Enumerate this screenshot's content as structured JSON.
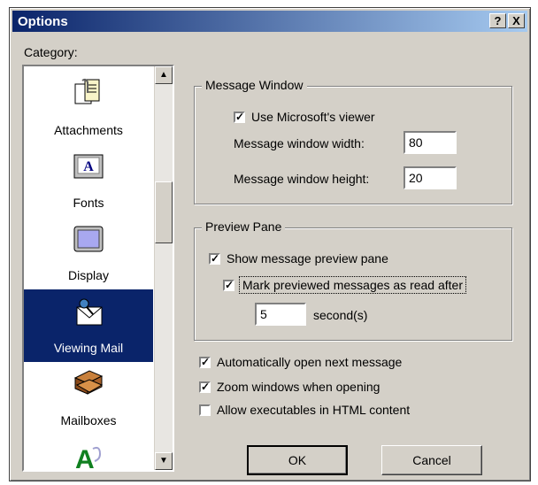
{
  "window": {
    "title": "Options",
    "help_button": "?",
    "close_button": "X"
  },
  "category_label": "Category:",
  "categories": [
    {
      "label": "Attachments",
      "icon": "attachments-icon"
    },
    {
      "label": "Fonts",
      "icon": "fonts-icon"
    },
    {
      "label": "Display",
      "icon": "display-icon"
    },
    {
      "label": "Viewing Mail",
      "icon": "viewing-mail-icon",
      "selected": true
    },
    {
      "label": "Mailboxes",
      "icon": "mailboxes-icon"
    },
    {
      "label": "",
      "icon": "spell-check-icon"
    }
  ],
  "message_window": {
    "legend": "Message Window",
    "use_viewer_label": "Use Microsoft's viewer",
    "use_viewer_checked": true,
    "width_label": "Message window width:",
    "width_value": "80",
    "height_label": "Message window height:",
    "height_value": "20"
  },
  "preview_pane": {
    "legend": "Preview Pane",
    "show_preview_label": "Show message preview pane",
    "show_preview_checked": true,
    "mark_read_label": "Mark previewed messages as read after",
    "mark_read_checked": true,
    "seconds_value": "5",
    "seconds_label": "second(s)"
  },
  "options": {
    "auto_open_label": "Automatically open next message",
    "auto_open_checked": true,
    "zoom_label": "Zoom windows when opening",
    "zoom_checked": true,
    "allow_exec_label": "Allow executables in HTML content",
    "allow_exec_checked": false
  },
  "buttons": {
    "ok": "OK",
    "cancel": "Cancel"
  },
  "colors": {
    "dialog_face": "#d4d0c8",
    "titlebar_start": "#0a246a",
    "titlebar_end": "#a6caf0",
    "selection": "#0a246a"
  }
}
